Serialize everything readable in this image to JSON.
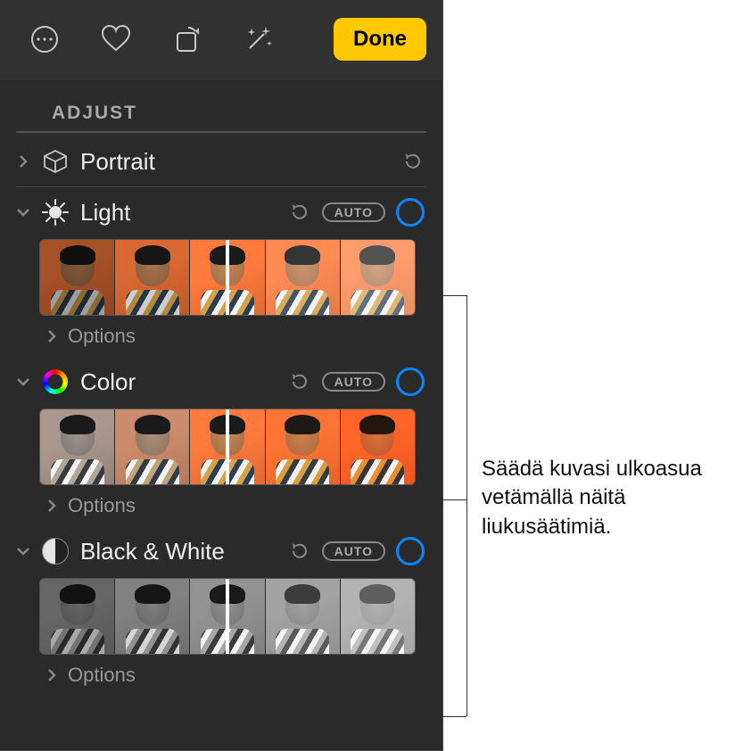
{
  "toolbar": {
    "done_label": "Done"
  },
  "header": {
    "title": "ADJUST"
  },
  "sections": {
    "portrait": {
      "label": "Portrait"
    },
    "light": {
      "label": "Light",
      "auto": "AUTO",
      "options": "Options"
    },
    "color": {
      "label": "Color",
      "auto": "AUTO",
      "options": "Options"
    },
    "bw": {
      "label": "Black & White",
      "auto": "AUTO",
      "options": "Options"
    }
  },
  "callout": {
    "text": "Säädä kuvasi ulkoasua vetämällä näitä liukusäätimiä."
  }
}
